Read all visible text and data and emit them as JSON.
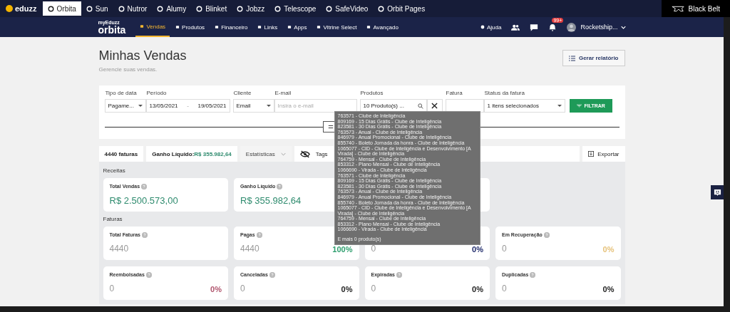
{
  "topbar": {
    "brand": "eduzz",
    "apps": [
      {
        "label": "Orbita",
        "selected": true
      },
      {
        "label": "Sun",
        "selected": false
      },
      {
        "label": "Nutror",
        "selected": false
      },
      {
        "label": "Alumy",
        "selected": false
      },
      {
        "label": "Blinket",
        "selected": false
      },
      {
        "label": "Jobzz",
        "selected": false
      },
      {
        "label": "Telescope",
        "selected": false
      },
      {
        "label": "SafeVideo",
        "selected": false
      },
      {
        "label": "Orbit Pages",
        "selected": false
      }
    ],
    "right": "Black Belt"
  },
  "nav": {
    "logo_small": "myEduzz",
    "logo": "orbita",
    "items": [
      {
        "label": "Vendas",
        "selected": true
      },
      {
        "label": "Produtos",
        "selected": false
      },
      {
        "label": "Financeiro",
        "selected": false
      },
      {
        "label": "Links",
        "selected": false
      },
      {
        "label": "Apps",
        "selected": false
      },
      {
        "label": "Vitrine Select",
        "selected": false
      },
      {
        "label": "Avançado",
        "selected": false
      }
    ],
    "help": "Ajuda",
    "badge": "99+",
    "user": "Rocketship..."
  },
  "header": {
    "title": "Minhas Vendas",
    "subtitle": "Gerencie suas vendas.",
    "report_button": "Gerar relatório"
  },
  "filters": {
    "date_type": {
      "label": "Tipo de data",
      "value": "Pagame..."
    },
    "period": {
      "label": "Período",
      "from": "13/05/2021",
      "sep": "-",
      "to": "19/05/2021"
    },
    "client": {
      "label": "Cliente",
      "value": "Email"
    },
    "email": {
      "label": "E-mail",
      "placeholder": "Insira o e-mail"
    },
    "products": {
      "label": "Produtos",
      "value": "10 Produto(s) ..."
    },
    "invoice": {
      "label": "Fatura"
    },
    "status": {
      "label": "Status da fatura",
      "value": "1 itens selecionados"
    },
    "button": "FILTRAR"
  },
  "tooltip": {
    "lines": [
      "763571 - Clube de Inteligência",
      "809169 - 15 Dias Grátis - Clube de Inteligência",
      "823581 - 30 Dias Grátis - Clube de Inteligência",
      "763573 - Anual - Clube de Inteligência",
      "846979 - Anual Promocional - Clube de Inteligência",
      "855740 - Boleto Jornada da honra - Clube de Inteligência",
      "1065077 - CID - Clube de Inteligência e Desenvolvimento [A Virada] - Clube de Inteligência",
      "764759 - Mensal - Clube de Inteligência",
      "853312 - Plano Mensal - Clube de Inteligência",
      "1066690 - Virada - Clube de Inteligência",
      "763571 - Clube de Inteligência",
      "809169 - 15 Dias Grátis - Clube de Inteligência",
      "823581 - 30 Dias Grátis - Clube de Inteligência",
      "763573 - Anual - Clube de Inteligência",
      "846979 - Anual Promocional - Clube de Inteligência",
      "855740 - Boleto Jornada da honra - Clube de Inteligência",
      "1065077 - CID - Clube de Inteligência e Desenvolvimento [A Virada] - Clube de Inteligência",
      "764759 - Mensal - Clube de Inteligência",
      "853312 - Plano Mensal - Clube de Inteligência",
      "1066690 - Virada - Clube de Inteligência"
    ],
    "more": "E mais 0 produto(s)"
  },
  "summary": {
    "count": "4440 faturas",
    "net_label": "Ganho Líquido:",
    "net_value": "R$ 355.982,64",
    "stats": "Estatísticas",
    "tags": "Tags",
    "export": "Exportar"
  },
  "receitas": {
    "title": "Receitas",
    "cards": [
      {
        "kind": "value",
        "label": "Total Vendas",
        "value": "R$ 2.500.573,00"
      },
      {
        "kind": "value",
        "label": "Ganho Líquido",
        "value": "R$ 355.982,64"
      },
      {
        "kind": "blank"
      }
    ]
  },
  "faturas": {
    "title": "Faturas",
    "cards": [
      {
        "label": "Total Faturas",
        "value": "4440"
      },
      {
        "label": "Pagas",
        "value": "4440",
        "percent": "100%",
        "color": "#2e9e6e"
      },
      {
        "value": "0",
        "percent": "0%",
        "color": "#1f2a6b"
      },
      {
        "label": "Em Recuperação",
        "value": "0",
        "percent": "0%",
        "color": "#e6c27a"
      },
      {
        "label": "Reembolsadas",
        "value": "0",
        "percent": "0%",
        "color": "#b0566e"
      },
      {
        "label": "Canceladas",
        "value": "0",
        "percent": "0%",
        "color": "#222222"
      },
      {
        "label": "Expiradas",
        "value": "0",
        "percent": "0%",
        "color": "#222222"
      },
      {
        "label": "Duplicadas",
        "value": "0",
        "percent": "0%",
        "color": "#222222"
      }
    ]
  }
}
